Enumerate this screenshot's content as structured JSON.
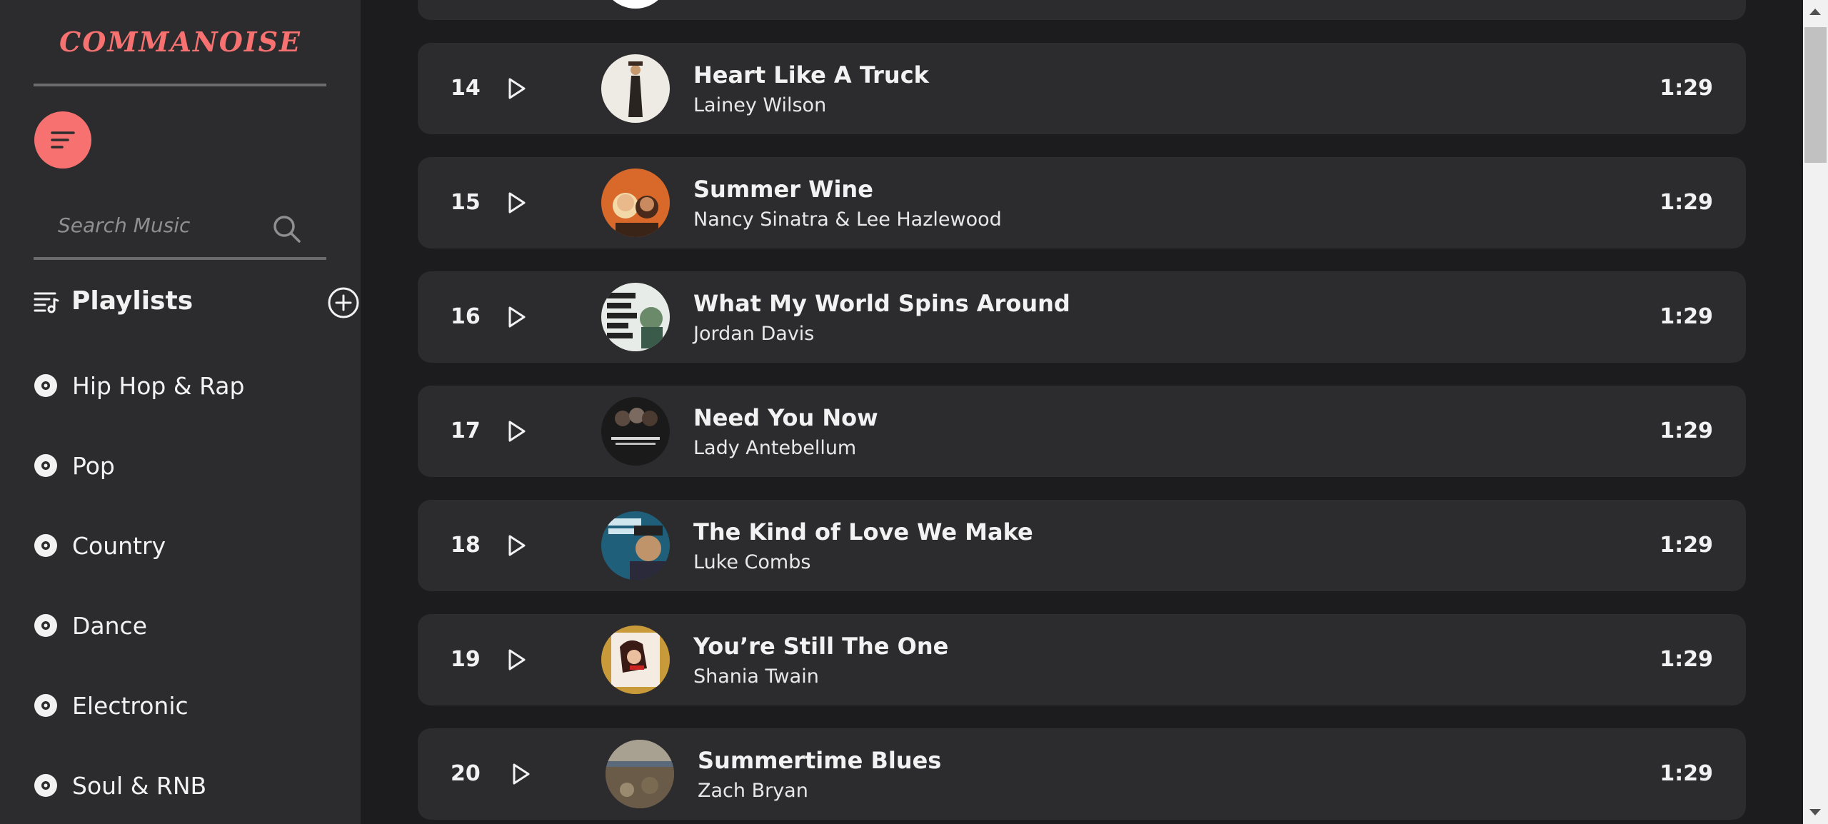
{
  "app": {
    "logo": "COMMANOISE"
  },
  "search": {
    "placeholder": "Search Music"
  },
  "playlists": {
    "title": "Playlists",
    "genres": [
      {
        "label": "Hip Hop & Rap"
      },
      {
        "label": "Pop"
      },
      {
        "label": "Country"
      },
      {
        "label": "Dance"
      },
      {
        "label": "Electronic"
      },
      {
        "label": "Soul & RNB"
      }
    ]
  },
  "tracks": [
    {
      "number": "14",
      "title": "Heart Like A Truck",
      "artist": "Lainey Wilson",
      "duration": "1:29"
    },
    {
      "number": "15",
      "title": "Summer Wine",
      "artist": "Nancy Sinatra & Lee Hazlewood",
      "duration": "1:29"
    },
    {
      "number": "16",
      "title": "What My World Spins Around",
      "artist": "Jordan Davis",
      "duration": "1:29"
    },
    {
      "number": "17",
      "title": "Need You Now",
      "artist": "Lady Antebellum",
      "duration": "1:29"
    },
    {
      "number": "18",
      "title": "The Kind of Love We Make",
      "artist": "Luke Combs",
      "duration": "1:29"
    },
    {
      "number": "19",
      "title": "You’re Still The One",
      "artist": "Shania Twain",
      "duration": "1:29"
    },
    {
      "number": "20",
      "title": "Summertime Blues",
      "artist": "Zach Bryan",
      "duration": "1:29"
    }
  ],
  "colors": {
    "accent": "#f87171",
    "sidebar_bg": "#2c2c2e",
    "main_bg": "#1c1c1e",
    "row_bg": "#2c2c2e"
  },
  "icons": {
    "menu": "menu-lines-icon",
    "search": "search-icon",
    "playlist": "playlist-icon",
    "add": "add-circle-icon",
    "genre": "disc-icon",
    "play": "play-icon"
  }
}
